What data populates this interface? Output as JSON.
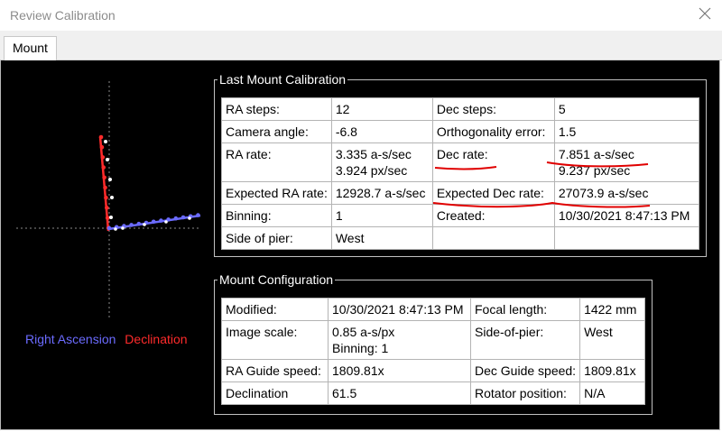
{
  "window": {
    "title": "Review Calibration",
    "close_icon": "close-icon"
  },
  "tabs": [
    {
      "label": "Mount",
      "selected": true
    }
  ],
  "graph": {
    "legend_ra": "Right Ascension",
    "legend_dec": "Declination",
    "colors": {
      "ra": "#6b6bff",
      "dec": "#ff2b2b",
      "background": "#000000"
    }
  },
  "last_mount_calibration": {
    "title": "Last Mount Calibration",
    "rows": [
      [
        "RA steps:",
        "12",
        "Dec steps:",
        "5"
      ],
      [
        "Camera angle:",
        "-6.8",
        "Orthogonality error:",
        "1.5"
      ],
      [
        "RA rate:",
        "3.335 a-s/sec\n3.924 px/sec",
        "Dec rate:",
        "7.851 a-s/sec\n9.237 px/sec"
      ],
      [
        "Expected RA rate:",
        "12928.7 a-s/sec",
        "Expected Dec rate:",
        "27073.9 a-s/sec"
      ],
      [
        "Binning:",
        "1",
        "Created:",
        "10/30/2021 8:47:13 PM"
      ],
      [
        "Side of pier:",
        "West",
        "",
        ""
      ]
    ]
  },
  "mount_configuration": {
    "title": "Mount Configuration",
    "rows": [
      [
        "Modified:",
        "10/30/2021 8:47:13 PM",
        "Focal length:",
        "1422 mm"
      ],
      [
        "Image scale:",
        "0.85 a-s/px\nBinning: 1",
        "Side-of-pier:",
        "West"
      ],
      [
        "RA Guide speed:",
        "1809.81x",
        "Dec Guide speed:",
        "1809.81x"
      ],
      [
        "Declination",
        "61.5",
        "Rotator position:",
        "N/A"
      ]
    ]
  }
}
